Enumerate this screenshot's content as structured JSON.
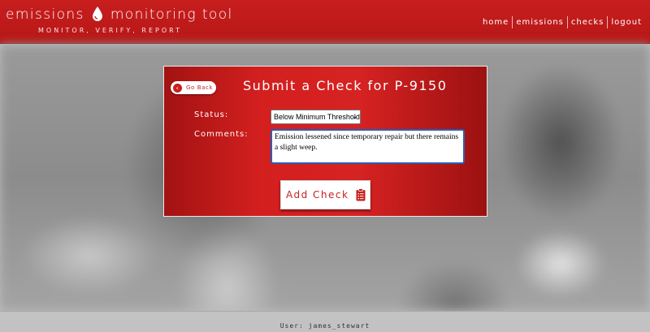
{
  "header": {
    "title_left": "emissions",
    "title_right": "monitoring tool",
    "tagline": "MONITOR, VERIFY, REPORT",
    "logo_icon": "droplet-icon"
  },
  "nav": {
    "items": [
      {
        "label": "home"
      },
      {
        "label": "emissions"
      },
      {
        "label": "checks"
      },
      {
        "label": "logout"
      }
    ]
  },
  "card": {
    "back_label": "Go Back",
    "back_icon": "arrow-left-circle-icon",
    "title": "Submit a Check for P-9150",
    "status_label": "Status:",
    "status_value": "Below Minimum Threshold",
    "comments_label": "Comments:",
    "comments_value": "Emission lessened since temporary repair but there remains a slight weep.",
    "submit_label": "Add Check",
    "submit_icon": "clipboard-list-icon"
  },
  "footer": {
    "user_text": "User: james_stewart"
  },
  "colors": {
    "brand_red": "#c81e1e",
    "white": "#ffffff",
    "input_focus": "#2d5eb5"
  }
}
